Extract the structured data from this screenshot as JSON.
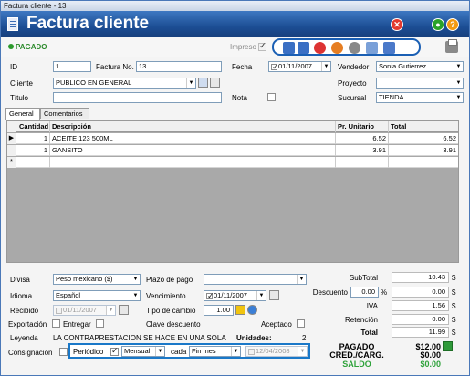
{
  "window": {
    "title": "Factura cliente - 13"
  },
  "header": {
    "title": "Factura cliente",
    "close_glyph": "✕",
    "go_glyph": "●",
    "help_glyph": "?"
  },
  "status": {
    "paid_label": "PAGADO",
    "impreso_label": "Impreso",
    "impreso_checked": true
  },
  "form": {
    "id_label": "ID",
    "id_value": "1",
    "factura_label": "Factura No.",
    "factura_value": "13",
    "fecha_label": "Fecha",
    "fecha_value": "01/11/2007",
    "vendedor_label": "Vendedor",
    "vendedor_value": "Sonia Gutierrez",
    "cliente_label": "Cliente",
    "cliente_value": "PUBLICO EN GENERAL",
    "proyecto_label": "Proyecto",
    "proyecto_value": "",
    "titulo_label": "Título",
    "titulo_value": "",
    "nota_label": "Nota",
    "sucursal_label": "Sucursal",
    "sucursal_value": "TIENDA"
  },
  "tabs": [
    {
      "label": "General"
    },
    {
      "label": "Comentarios"
    }
  ],
  "grid": {
    "columns": [
      "Cantidad",
      "Descripción",
      "Pr. Unitario",
      "Total"
    ],
    "rows": [
      {
        "qty": "1",
        "desc": "ACEITE 123 500ML",
        "price": "6.52",
        "total": "6.52"
      },
      {
        "qty": "1",
        "desc": "GANSITO",
        "price": "3.91",
        "total": "3.91"
      }
    ],
    "new_row_marker": "*",
    "current_row_marker": "▶"
  },
  "bottom": {
    "divisa_label": "Divisa",
    "divisa_value": "Peso mexicano ($)",
    "plazo_label": "Plazo de pago",
    "plazo_value": "",
    "idioma_label": "Idioma",
    "idioma_value": "Español",
    "vencimiento_label": "Vencimiento",
    "vencimiento_value": "01/11/2007",
    "recibido_label": "Recibido",
    "recibido_value": "01/11/2007",
    "tipo_cambio_label": "Tipo de cambio",
    "tipo_cambio_value": "1.00",
    "exportacion_label": "Exportación",
    "entregar_label": "Entregar",
    "clave_descuento_label": "Clave descuento",
    "aceptado_label": "Aceptado",
    "leyenda_label": "Leyenda",
    "leyenda_value": "LA CONTRAPRESTACION SE HACE EN UNA SOLA EXHII",
    "unidades_label": "Unidades:",
    "unidades_value": "2",
    "consignacion_label": "Consignación",
    "periodico_label": "Periódico",
    "periodico_checked": true,
    "frecuencia_value": "Mensual",
    "cada_label": "cada",
    "cada_value": "Fin mes",
    "fecha_fin_value": "12/04/2008"
  },
  "totals": {
    "subtotal_label": "SubTotal",
    "subtotal_value": "10.43",
    "descuento_label": "Descuento",
    "descuento_pct": "0.00",
    "pct_symbol": "%",
    "descuento_value": "0.00",
    "iva_label": "IVA",
    "iva_value": "1.56",
    "retencion_label": "Retención",
    "retencion_value": "0.00",
    "total_label": "Total",
    "total_value": "11.99",
    "currency_symbol": "$",
    "pagado_label": "PAGADO",
    "pagado_value": "$12.00",
    "cred_label": "CRED./CARG.",
    "cred_value": "$0.00",
    "saldo_label": "SALDO",
    "saldo_value": "$0.00"
  },
  "colors": {
    "header": "#1c4e94",
    "paid": "#2c8a2c",
    "highlight": "#1a78c8"
  }
}
